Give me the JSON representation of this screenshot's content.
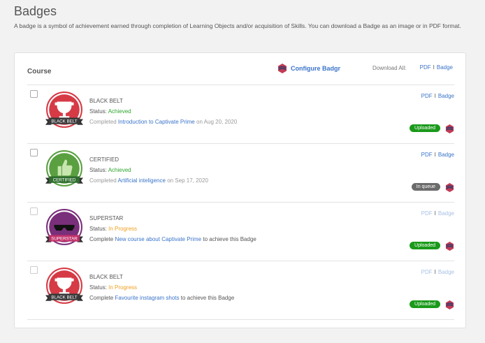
{
  "page": {
    "title": "Badges",
    "description": "A badge is a symbol of achievement earned through completion of Learning Objects and/or acquisition of Skills. You can download a Badge as an image or in PDF format."
  },
  "header": {
    "course_label": "Course",
    "configure": "Configure Badgr",
    "download_all": "Download All:",
    "pdf": "PDF",
    "sep": "I",
    "badge": "Badge"
  },
  "rows": [
    {
      "name": "BLACK BELT",
      "status_label": "Status:",
      "status": "Achieved",
      "pre": "Completed",
      "course": "Introduction to Captivate Prime",
      "post": "on Aug 20, 2020",
      "pill": "Uploaded",
      "ribbon": "BLACK BELT"
    },
    {
      "name": "CERTIFIED",
      "status_label": "Status:",
      "status": "Achieved",
      "pre": "Completed",
      "course": "Artificial inteligence",
      "post": "on Sep 17, 2020",
      "pill": "In queue",
      "ribbon": "CERTIFIED"
    },
    {
      "name": "SUPERSTAR",
      "status_label": "Status:",
      "status": "In Progress",
      "pre": "Complete",
      "course": "New course about Captivate Prime",
      "post": "to achieve this Badge",
      "pill": "Uploaded",
      "ribbon": "SUPERSTAR"
    },
    {
      "name": "BLACK BELT",
      "status_label": "Status:",
      "status": "In Progress",
      "pre": "Complete",
      "course": "Favourite instagram shots",
      "post": "to achieve this Badge",
      "pill": "Uploaded",
      "ribbon": "BLACK BELT"
    }
  ],
  "colors": {
    "uploaded": "#1a9a1a",
    "queue": "#6b6b6b",
    "red": "#d63a45",
    "green": "#5aa040",
    "purple": "#7a2f7a"
  }
}
